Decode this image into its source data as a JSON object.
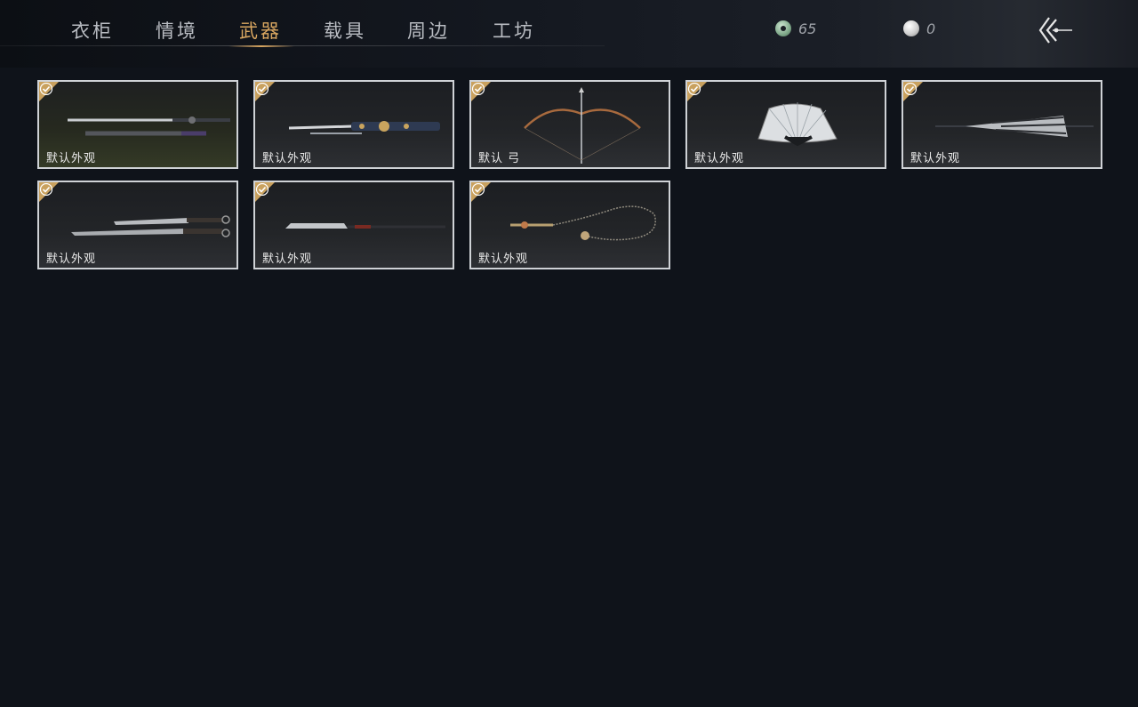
{
  "nav": {
    "tabs": [
      "衣柜",
      "情境",
      "武器",
      "载具",
      "周边",
      "工坊"
    ],
    "active_tab": "武器"
  },
  "currency": {
    "jade_value": "65",
    "pearl_value": "0"
  },
  "icons": {
    "jade": "jade-coin-icon",
    "pearl": "pearl-icon",
    "back": "back-arrow-icon",
    "check": "checkmark-icon"
  },
  "colors": {
    "accent": "#d8a660",
    "check_badge": "#c9a15e",
    "card_border": "#cfd2d6",
    "background": "#0f131a"
  },
  "weapons": [
    {
      "label": "默认外观",
      "art": "sword-pair-icon"
    },
    {
      "label": "默认外观",
      "art": "ornate-sword-icon"
    },
    {
      "label": "默认 弓",
      "art": "bow-icon"
    },
    {
      "label": "默认外观",
      "art": "folding-fan-icon"
    },
    {
      "label": "默认外观",
      "art": "umbrella-icon"
    },
    {
      "label": "默认外观",
      "art": "twin-blades-icon"
    },
    {
      "label": "默认外观",
      "art": "glaive-icon"
    },
    {
      "label": "默认外观",
      "art": "rope-dart-icon"
    }
  ]
}
